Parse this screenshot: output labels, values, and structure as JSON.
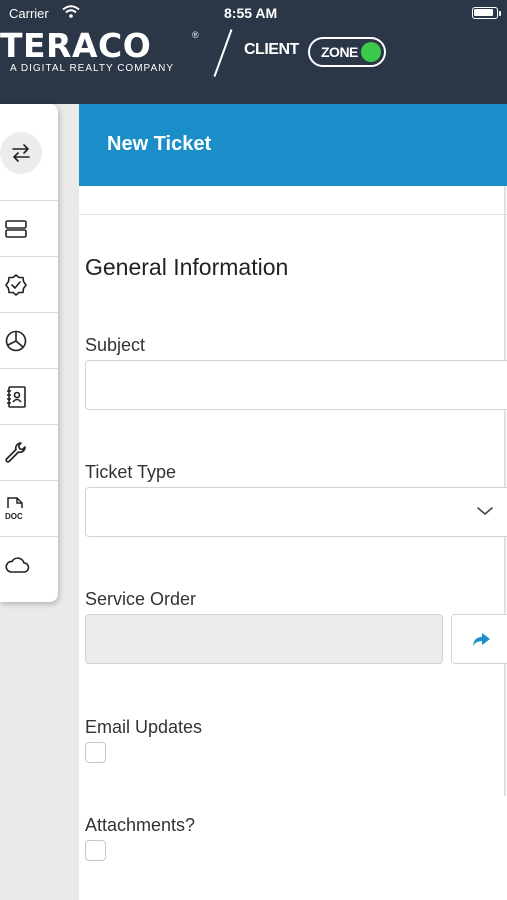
{
  "status_bar": {
    "carrier": "Carrier",
    "time": "8:55 AM"
  },
  "brand": {
    "logo_text": "TERACO",
    "tagline": "A DIGITAL REALTY COMPANY",
    "client_text": "CLIENT",
    "zone_text": "ZONE",
    "header_color": "#2b3646",
    "zone_dot_color": "#3cc84a"
  },
  "sidebar": {
    "collapse_icon": "swap-arrows-icon",
    "items": [
      {
        "icon": "server-stack-icon"
      },
      {
        "icon": "verified-badge-icon"
      },
      {
        "icon": "pie-chart-icon"
      },
      {
        "icon": "contacts-book-icon"
      },
      {
        "icon": "wrench-icon"
      },
      {
        "icon": "doc-file-icon"
      },
      {
        "icon": "cloud-icon"
      }
    ]
  },
  "panel": {
    "title": "New Ticket",
    "accent_color": "#1b8ec9",
    "section_title": "General Information",
    "fields": {
      "subject": {
        "label": "Subject",
        "value": ""
      },
      "ticket_type": {
        "label": "Ticket Type",
        "value": ""
      },
      "service_order": {
        "label": "Service Order",
        "value": ""
      },
      "email_updates": {
        "label": "Email Updates",
        "checked": false
      },
      "attachments": {
        "label": "Attachments?",
        "checked": false
      }
    }
  }
}
